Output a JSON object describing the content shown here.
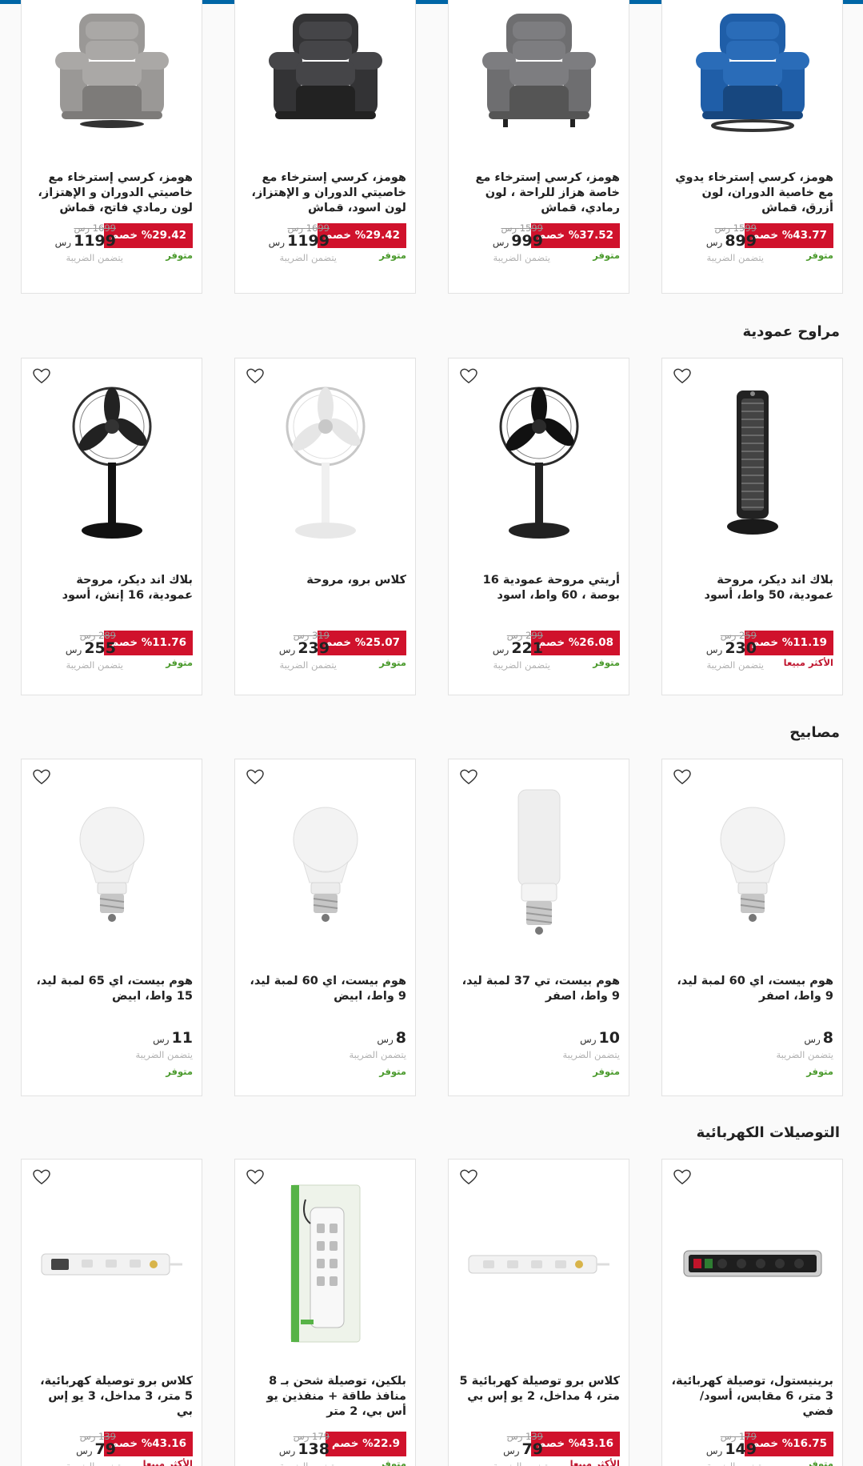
{
  "colors": {
    "accent": "#0066a6",
    "discount": "#d0122c",
    "in_stock": "#4a9a2c",
    "best_seller": "#c01730"
  },
  "sections": [
    {
      "title": "",
      "products": [
        {
          "name": "هومز، كرسي إسترخاء يدوي مع خاصية الدوران، لون أزرق، قماش",
          "discount": "%43.77 خصم",
          "old_price": "1599 رس",
          "price": "899",
          "currency": "رس",
          "tax": "يتضمن الضريبة",
          "stock": "متوفر",
          "image": "recliner-blue"
        },
        {
          "name": "هومز، كرسي إسترخاء مع خاصة هزاز للراحة ، لون رمادي، قماش",
          "discount": "%37.52 خصم",
          "old_price": "1599 رس",
          "price": "999",
          "currency": "رس",
          "tax": "يتضمن الضريبة",
          "stock": "متوفر",
          "image": "recliner-grey"
        },
        {
          "name": "هومز، كرسي إسترخاء مع خاصيتي الدوران و الإهتزاز، لون اسود، قماش",
          "discount": "%29.42 خصم",
          "old_price": "1699 رس",
          "price": "1199",
          "currency": "رس",
          "tax": "يتضمن الضريبة",
          "stock": "متوفر",
          "image": "recliner-black"
        },
        {
          "name": "هومز، كرسي إسترخاء مع خاصيتي الدوران و الإهتزاز، لون رمادي فاتح، قماش",
          "discount": "%29.42 خصم",
          "old_price": "1699 رس",
          "price": "1199",
          "currency": "رس",
          "tax": "يتضمن الضريبة",
          "stock": "متوفر",
          "image": "recliner-lightgrey"
        }
      ]
    },
    {
      "title": "مراوح عمودية",
      "products": [
        {
          "name": "بلاك اند ديكر، مروحة عمودية، 50 واط، أسود",
          "discount": "%11.19 خصم",
          "old_price": "259 رس",
          "price": "230",
          "currency": "رس",
          "tax": "يتضمن الضريبة",
          "stock": "الأكثر مبيعا",
          "image": "tower-fan"
        },
        {
          "name": "أريتي مروحة عمودية 16 بوصة ، 60 واط، اسود",
          "discount": "%26.08 خصم",
          "old_price": "299 رس",
          "price": "221",
          "currency": "رس",
          "tax": "يتضمن الضريبة",
          "stock": "متوفر",
          "image": "stand-fan-black"
        },
        {
          "name": "كلاس برو، مروحة",
          "discount": "%25.07 خصم",
          "old_price": "319 رس",
          "price": "239",
          "currency": "رس",
          "tax": "يتضمن الضريبة",
          "stock": "متوفر",
          "image": "stand-fan-white"
        },
        {
          "name": "بلاك اند ديكر، مروحة عمودية، 16 إنش، أسود",
          "discount": "%11.76 خصم",
          "old_price": "289 رس",
          "price": "255",
          "currency": "رس",
          "tax": "يتضمن الضريبة",
          "stock": "متوفر",
          "image": "stand-fan-bd"
        }
      ]
    },
    {
      "title": "مصابيح",
      "products": [
        {
          "name": "هوم بيست، اي 60 لمبة ليد، 9 واط، اصفر",
          "discount": "",
          "old_price": "",
          "price": "8",
          "currency": "رس",
          "tax": "يتضمن الضريبة",
          "stock": "متوفر",
          "image": "bulb-a60"
        },
        {
          "name": "هوم بيست، تي 37 لمبة ليد، 9 واط، اصفر",
          "discount": "",
          "old_price": "",
          "price": "10",
          "currency": "رس",
          "tax": "يتضمن الضريبة",
          "stock": "متوفر",
          "image": "bulb-t37"
        },
        {
          "name": "هوم بيست، اي 60 لمبة ليد، 9 واط، ابيض",
          "discount": "",
          "old_price": "",
          "price": "8",
          "currency": "رس",
          "tax": "يتضمن الضريبة",
          "stock": "متوفر",
          "image": "bulb-a60"
        },
        {
          "name": "هوم بيست، اي 65 لمبة ليد، 15 واط، ابيض",
          "discount": "",
          "old_price": "",
          "price": "11",
          "currency": "رس",
          "tax": "يتضمن الضريبة",
          "stock": "متوفر",
          "image": "bulb-a65"
        }
      ]
    },
    {
      "title": "التوصيلات الكهربائية",
      "products": [
        {
          "name": "برينيستول، توصيلة كهربائية، 3 متر، 6 مقابس، أسود/فضي",
          "discount": "%16.75 خصم",
          "old_price": "179 رس",
          "price": "149",
          "currency": "رس",
          "tax": "يتضمن الضريبة",
          "stock": "متوفر",
          "image": "strip-black"
        },
        {
          "name": "كلاس برو توصيلة كهربائية 5 متر، 4 مداخل، 2 يو إس بي",
          "discount": "%43.16 خصم",
          "old_price": "139 رس",
          "price": "79",
          "currency": "رس",
          "tax": "يتضمن الضريبة",
          "stock": "الأكثر مبيعا",
          "image": "strip-white-4"
        },
        {
          "name": "بلكين، توصيلة شحن بـ 8 منافذ طاقة + منفذين يو أس بي، 2 متر",
          "discount": "%22.9 خصم",
          "old_price": "179 رس",
          "price": "138",
          "currency": "رس",
          "tax": "يتضمن الضريبة",
          "stock": "متوفر",
          "image": "strip-belkin"
        },
        {
          "name": "كلاس برو توصيلة كهربائية، 5 متر، 3 مداخل، 3 يو إس بي",
          "discount": "%43.16 خصم",
          "old_price": "139 رس",
          "price": "79",
          "currency": "رس",
          "tax": "يتضمن الضريبة",
          "stock": "الأكثر مبيعا",
          "image": "strip-white-3"
        }
      ]
    }
  ]
}
